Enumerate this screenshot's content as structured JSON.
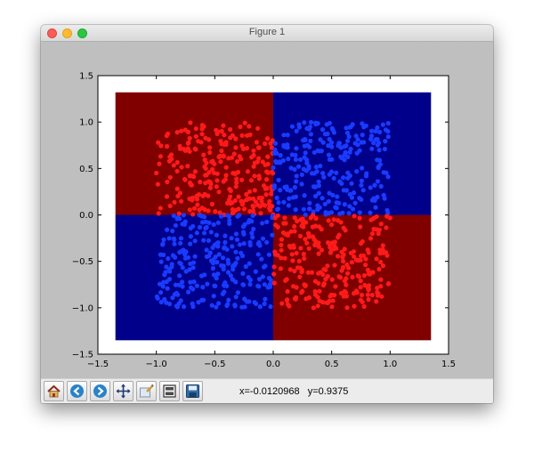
{
  "window": {
    "title": "Figure 1"
  },
  "toolbar": {
    "buttons": [
      {
        "name": "home-button",
        "icon": "home-icon"
      },
      {
        "name": "back-button",
        "icon": "back-arrow-icon"
      },
      {
        "name": "forward-button",
        "icon": "forward-arrow-icon"
      },
      {
        "name": "pan-button",
        "icon": "pan-icon"
      },
      {
        "name": "zoom-button",
        "icon": "zoom-icon"
      },
      {
        "name": "configure-subplots-button",
        "icon": "subplots-icon"
      },
      {
        "name": "save-button",
        "icon": "save-icon"
      }
    ],
    "coords": "x=-0.0120968   y=0.9375"
  },
  "chart_data": {
    "type": "scatter",
    "xlim": [
      -1.5,
      1.5
    ],
    "ylim": [
      -1.5,
      1.5
    ],
    "xticks": [
      "−1.5",
      "−1.0",
      "−0.5",
      "0.0",
      "0.5",
      "1.0",
      "1.5"
    ],
    "yticks": [
      "−1.5",
      "−1.0",
      "−0.5",
      "0.0",
      "0.5",
      "1.0",
      "1.5"
    ],
    "grid": false,
    "background_regions": [
      {
        "x": [
          -1.35,
          0.0
        ],
        "y": [
          0.0,
          1.32
        ],
        "color": "#800000"
      },
      {
        "x": [
          0.0,
          1.35
        ],
        "y": [
          0.0,
          1.32
        ],
        "color": "#00008b"
      },
      {
        "x": [
          -1.35,
          0.0
        ],
        "y": [
          -1.35,
          0.0
        ],
        "color": "#00008b"
      },
      {
        "x": [
          0.0,
          1.35
        ],
        "y": [
          -1.35,
          0.0
        ],
        "color": "#800000"
      }
    ],
    "series": [
      {
        "color": "#ff1a1a",
        "x_range": [
          -1.0,
          0.0
        ],
        "y_range": [
          0.0,
          1.0
        ],
        "count": 250
      },
      {
        "color": "#1a3bff",
        "x_range": [
          0.0,
          1.0
        ],
        "y_range": [
          0.0,
          1.0
        ],
        "count": 250
      },
      {
        "color": "#1a3bff",
        "x_range": [
          -1.0,
          0.0
        ],
        "y_range": [
          -1.0,
          0.0
        ],
        "count": 250
      },
      {
        "color": "#ff1a1a",
        "x_range": [
          0.0,
          1.0
        ],
        "y_range": [
          -1.0,
          0.0
        ],
        "count": 250
      }
    ]
  }
}
